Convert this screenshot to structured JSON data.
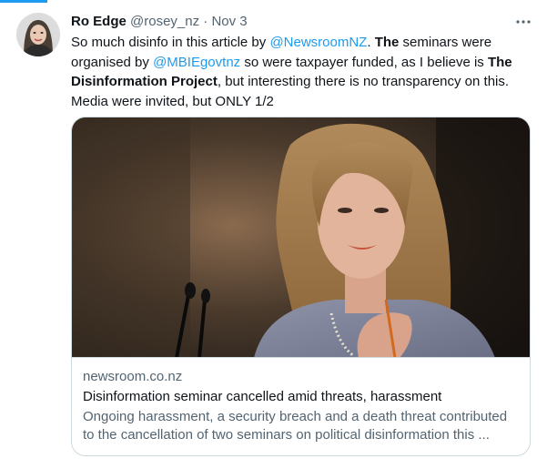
{
  "tweet": {
    "author_name": "Ro Edge",
    "handle": "@rosey_nz",
    "separator": "·",
    "date": "Nov 3",
    "more_icon": "more-horizontal-icon",
    "text_parts": {
      "t1": "So much disinfo in this article by ",
      "m1": "@NewsroomNZ",
      "t2": ". ",
      "b1": "The",
      "t3": " seminars were organised by ",
      "m2": "@MBIEgovtnz",
      "t4": " so were taxpayer funded, as I believe is ",
      "b2": "The Disinformation Project",
      "t5": ", but interesting there is no transparency on this. Media were invited, but ONLY 1/2"
    },
    "colors": {
      "link": "#1d9bf0",
      "secondary": "#536471",
      "primary": "#0f1419",
      "border": "#cfd9de"
    }
  },
  "card": {
    "domain": "newsroom.co.nz",
    "title": "Disinformation seminar cancelled amid threats, harassment",
    "description": "Ongoing harassment, a security breach and a death threat contributed to the cancellation of two seminars on political disinformation this ..."
  }
}
